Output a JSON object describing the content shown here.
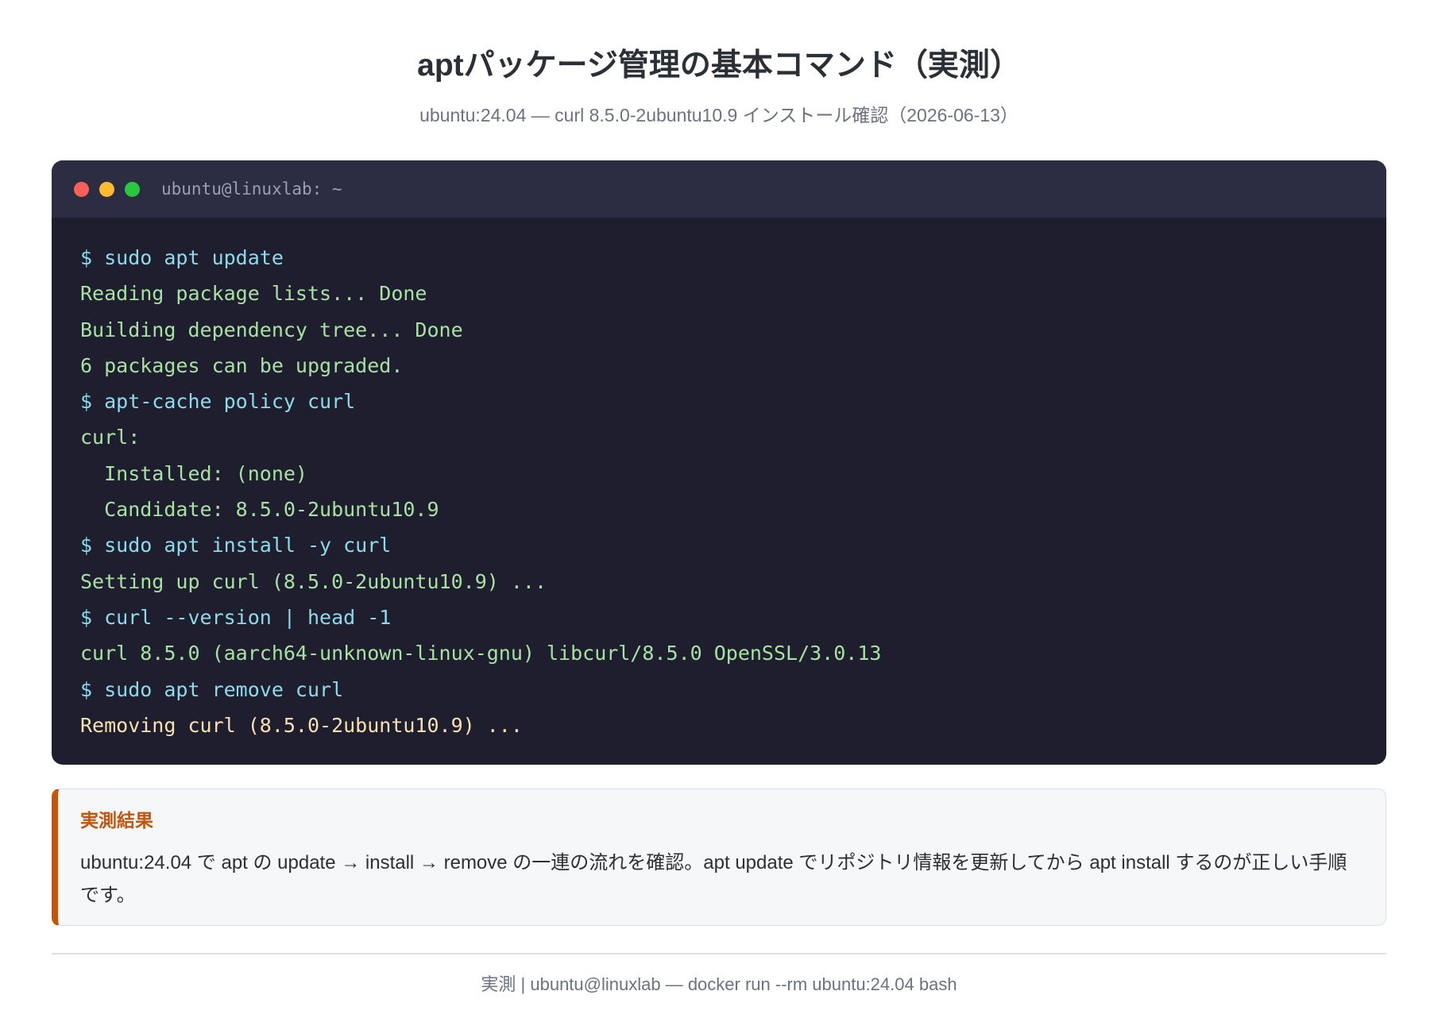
{
  "header": {
    "title": "aptパッケージ管理の基本コマンド（実測）",
    "subtitle": "ubuntu:24.04 — curl 8.5.0-2ubuntu10.9 インストール確認（2026-06-13）"
  },
  "terminal": {
    "title": "ubuntu@linuxlab: ~",
    "window_buttons": [
      {
        "name": "close",
        "color": "#ff5f57"
      },
      {
        "name": "minimize",
        "color": "#febc2e"
      },
      {
        "name": "maximize",
        "color": "#28c840"
      }
    ],
    "colors": {
      "command": "#89dceb",
      "output": "#a6e3a1",
      "highlight": "#f9e2af"
    },
    "lines": [
      {
        "text": "$ sudo apt update",
        "kind": "command"
      },
      {
        "text": "Reading package lists... Done",
        "kind": "output"
      },
      {
        "text": "Building dependency tree... Done",
        "kind": "output"
      },
      {
        "text": "6 packages can be upgraded.",
        "kind": "output"
      },
      {
        "text": "$ apt-cache policy curl",
        "kind": "command"
      },
      {
        "text": "curl:",
        "kind": "output"
      },
      {
        "text": "  Installed: (none)",
        "kind": "output"
      },
      {
        "text": "  Candidate: 8.5.0-2ubuntu10.9",
        "kind": "output"
      },
      {
        "text": "$ sudo apt install -y curl",
        "kind": "command"
      },
      {
        "text": "Setting up curl (8.5.0-2ubuntu10.9) ...",
        "kind": "output"
      },
      {
        "text": "$ curl --version | head -1",
        "kind": "command"
      },
      {
        "text": "curl 8.5.0 (aarch64-unknown-linux-gnu) libcurl/8.5.0 OpenSSL/3.0.13",
        "kind": "output"
      },
      {
        "text": "$ sudo apt remove curl",
        "kind": "command"
      },
      {
        "text": "Removing curl (8.5.0-2ubuntu10.9) ...",
        "kind": "highlight"
      }
    ]
  },
  "result": {
    "title": "実測結果",
    "text": "ubuntu:24.04 で apt の update → install → remove の一連の流れを確認。apt update でリポジトリ情報を更新してから apt install するのが正しい手順です。",
    "accent_color": "#c2570c"
  },
  "footer": {
    "text": "実測 | ubuntu@linuxlab — docker run --rm ubuntu:24.04 bash"
  }
}
